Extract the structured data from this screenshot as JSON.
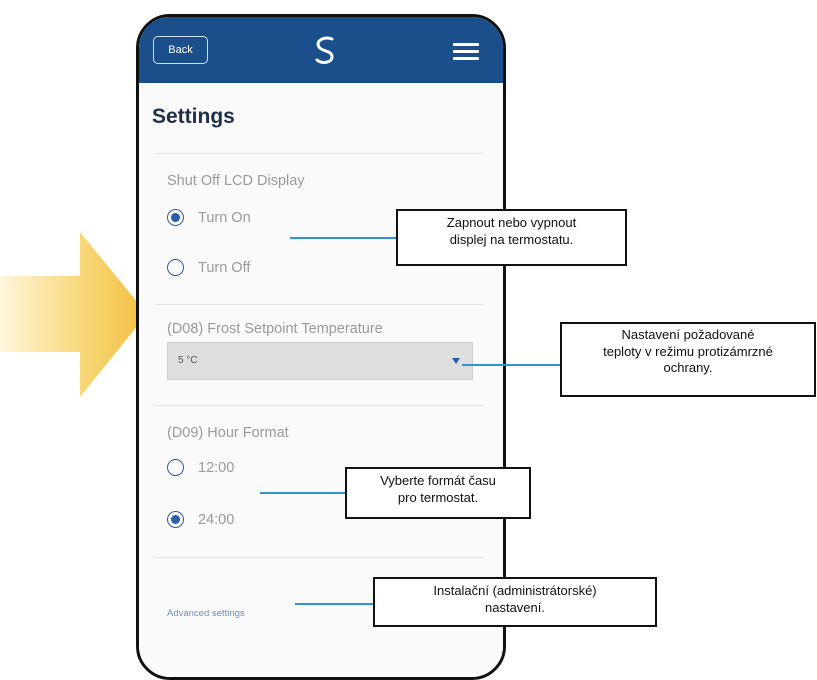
{
  "header": {
    "back_label": "Back",
    "logo_icon": "logo-icon",
    "menu_icon": "hamburger-menu-icon",
    "color": "#1a4f8c"
  },
  "page": {
    "title": "Settings"
  },
  "lcd_section": {
    "title": "Shut Off LCD Display",
    "options": [
      {
        "label": "Turn On",
        "selected": true
      },
      {
        "label": "Turn Off",
        "selected": false
      }
    ]
  },
  "frost_section": {
    "title": "(D08) Frost Setpoint Temperature",
    "value": "5 °C"
  },
  "hour_section": {
    "title": "(D09) Hour Format",
    "options": [
      {
        "label": "12:00",
        "selected": false
      },
      {
        "label": "24:00",
        "selected": true
      }
    ]
  },
  "advanced_link": "Advanced settings",
  "callouts": {
    "lcd": [
      "Zapnout nebo vypnout",
      "displej na termostatu."
    ],
    "frost": [
      "Nastavení požadované",
      "teploty v režimu protizámrzné",
      "ochrany."
    ],
    "hour": [
      "Vyberte formát času",
      "pro termostat."
    ],
    "advanced": [
      "Instalační (administrátorské)",
      "nastavení."
    ]
  },
  "colors": {
    "accent": "#2a5da8",
    "callout_line": "#2f95cf",
    "arrow": "#f5c24a"
  }
}
